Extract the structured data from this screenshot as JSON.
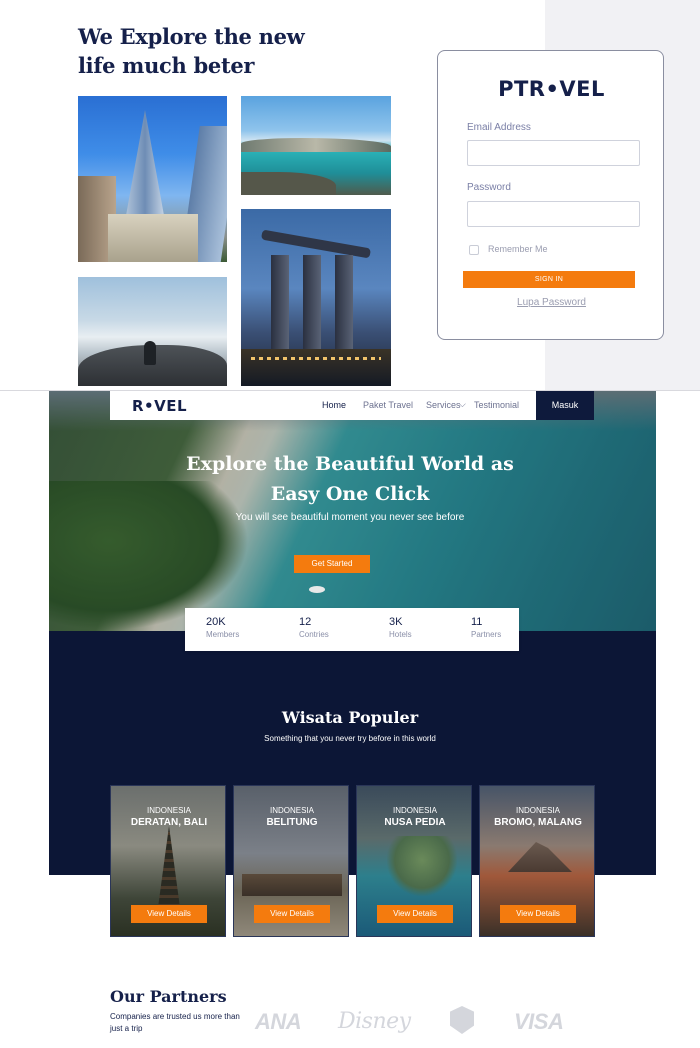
{
  "login": {
    "headline": "We Explore the new life much beter",
    "card": {
      "logo": "PTR•VEL",
      "email_label": "Email Address",
      "email_value": "",
      "password_label": "Password",
      "password_value": "",
      "remember_label": "Remember Me",
      "sign_in_label": "SIGN IN",
      "forgot_label": "Lupa Password"
    }
  },
  "nav": {
    "logo": "R•VEL",
    "items": [
      "Home",
      "Paket Travel",
      "Services",
      "Testimonial"
    ],
    "login_button": "Masuk"
  },
  "hero": {
    "title": "Explore the Beautiful World as Easy One Click",
    "subtitle": "You will see  beautiful moment you never see before",
    "cta": "Get Started"
  },
  "stats": [
    {
      "value": "20K",
      "label": "Members"
    },
    {
      "value": "12",
      "label": "Contries"
    },
    {
      "value": "3K",
      "label": "Hotels"
    },
    {
      "value": "11",
      "label": "Partners"
    }
  ],
  "popular": {
    "title": "Wisata Populer",
    "subtitle": "Something that you never try before in this world",
    "destinations": [
      {
        "country": "INDONESIA",
        "name": "DERATAN, BALI",
        "button": "View Details"
      },
      {
        "country": "INDONESIA",
        "name": "BELITUNG",
        "button": "View Details"
      },
      {
        "country": "INDONESIA",
        "name": "NUSA PEDIA",
        "button": "View Details"
      },
      {
        "country": "INDONESIA",
        "name": "BROMO, MALANG",
        "button": "View Details"
      }
    ]
  },
  "partners": {
    "title": "Our Partners",
    "subtitle": "Companies are trusted us more than just a trip",
    "logos": [
      "ANA",
      "Disney",
      "VISA"
    ]
  },
  "colors": {
    "primary": "#15204a",
    "accent": "#f47b0e",
    "dark": "#0c1636"
  }
}
